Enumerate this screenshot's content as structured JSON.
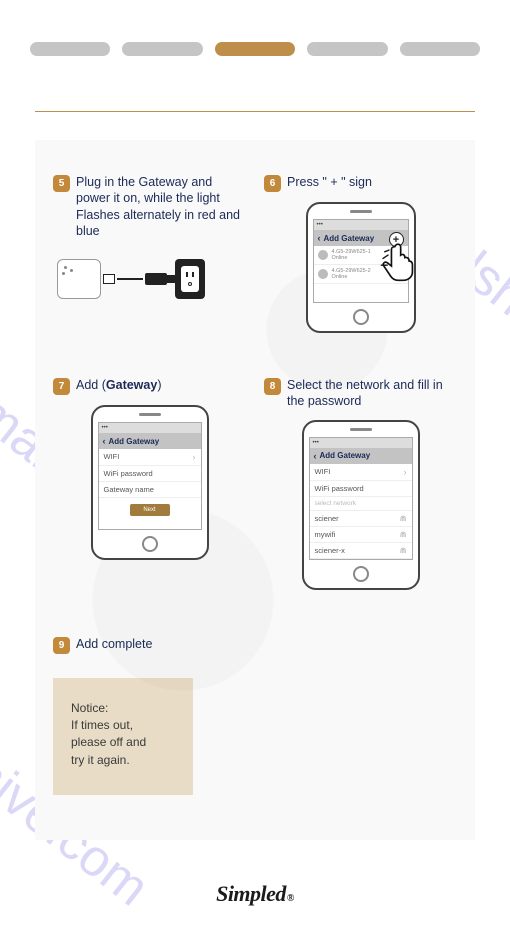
{
  "pills": {
    "active_index": 2
  },
  "steps": {
    "s5": {
      "num": "5",
      "title": "Plug in the Gateway and power it on, while the light Flashes alternately in red and blue"
    },
    "s6": {
      "num": "6",
      "title": "Press \" + \" sign",
      "screen_title": "Add Gateway",
      "row1_main": "4.G5-29W625-1",
      "row1_sub": "Online",
      "row2_main": "4.G5-29W625-2",
      "row2_sub": "Online"
    },
    "s7": {
      "num": "7",
      "title_pre": "Add (",
      "title_bold": "Gateway",
      "title_post": ")",
      "screen_title": "Add Gateway",
      "field1": "WIFI",
      "field2": "WiFi password",
      "field3": "Gateway name",
      "button": "Next"
    },
    "s8": {
      "num": "8",
      "title": "Select the network and fill in the password",
      "screen_title": "Add Gateway",
      "field1": "WIFI",
      "field2": "WiFi password",
      "section": "select network",
      "net1": "sciener",
      "net2": "mywifi",
      "net3": "sciener-x"
    },
    "s9": {
      "num": "9",
      "title": "Add complete"
    }
  },
  "notice": {
    "heading": "Notice:",
    "line1": "If times out,",
    "line2": "please off and",
    "line3": "try it again."
  },
  "brand": "Simpled",
  "watermark": "manualshive.com"
}
